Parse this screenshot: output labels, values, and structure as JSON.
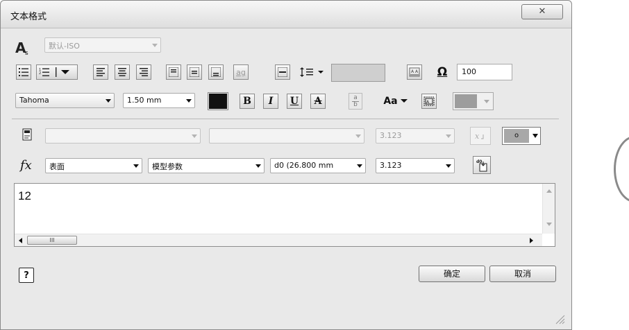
{
  "window": {
    "title": "文本格式",
    "close_glyph": "✕"
  },
  "row1": {
    "style_value": "默认-ISO"
  },
  "row2": {
    "width_factor": "100",
    "ag_label": "ag",
    "omega_glyph": "Ω"
  },
  "row3": {
    "font_value": "Tahoma",
    "size_value": "1.50 mm",
    "bold": "B",
    "italic": "I",
    "underline": "U",
    "strike": "A",
    "fraction_top": "a",
    "fraction_bottom": "b",
    "case_glyph": "Aa",
    "text_color": "#111111"
  },
  "params": {
    "param_value": "3.123",
    "fx_label": "fx",
    "source_value": "表面",
    "type_value": "模型参数",
    "param_name_value": "d0 (26.800 mm",
    "precision_value": "3.123",
    "dot_label": "o"
  },
  "editor": {
    "text": "12",
    "hscroll_grip": "III"
  },
  "footer": {
    "ok_label": "确定",
    "cancel_label": "取消",
    "help_glyph": "?"
  }
}
